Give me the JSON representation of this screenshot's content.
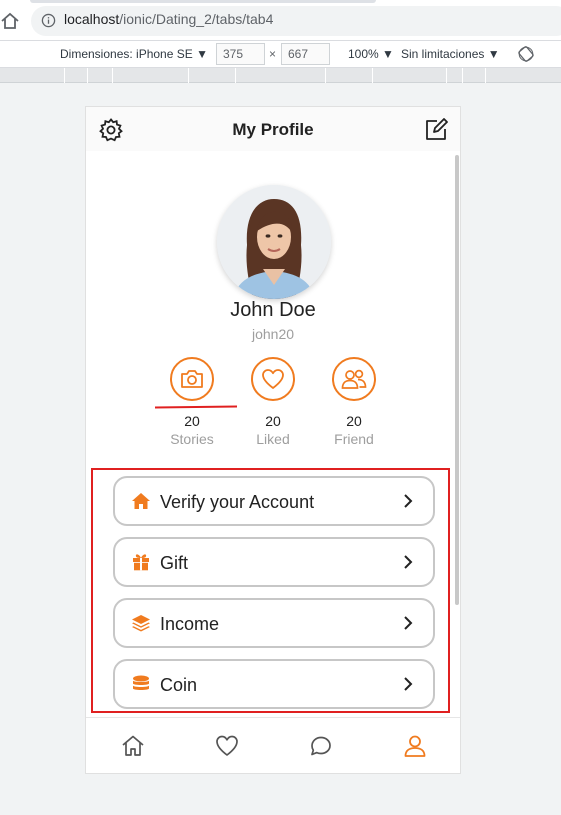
{
  "browser": {
    "url_host": "localhost",
    "url_path": "/ionic/Dating_2/tabs/tab4"
  },
  "devtools": {
    "device_label": "Dimensiones: iPhone SE",
    "width": "375",
    "times": "×",
    "height": "667",
    "zoom": "100%",
    "throttle": "Sin limitaciones"
  },
  "header": {
    "title": "My Profile",
    "left_icon": "gear-icon",
    "right_icon": "edit-icon"
  },
  "profile": {
    "name": "John Doe",
    "username": "john20"
  },
  "stats": [
    {
      "icon": "camera-icon",
      "count": "20",
      "label": "Stories"
    },
    {
      "icon": "heart-icon",
      "count": "20",
      "label": "Liked"
    },
    {
      "icon": "people-icon",
      "count": "20",
      "label": "Friend"
    }
  ],
  "menu": [
    {
      "icon": "home-icon",
      "label": "Verify your Account"
    },
    {
      "icon": "gift-icon",
      "label": "Gift"
    },
    {
      "icon": "layers-icon",
      "label": "Income"
    },
    {
      "icon": "coins-icon",
      "label": "Coin"
    }
  ],
  "tabs": [
    {
      "icon": "home-icon",
      "active": false
    },
    {
      "icon": "heart-icon",
      "active": false
    },
    {
      "icon": "chat-icon",
      "active": false
    },
    {
      "icon": "person-icon",
      "active": true
    }
  ],
  "colors": {
    "accent": "#f07b1f",
    "annotation": "#e02020"
  }
}
